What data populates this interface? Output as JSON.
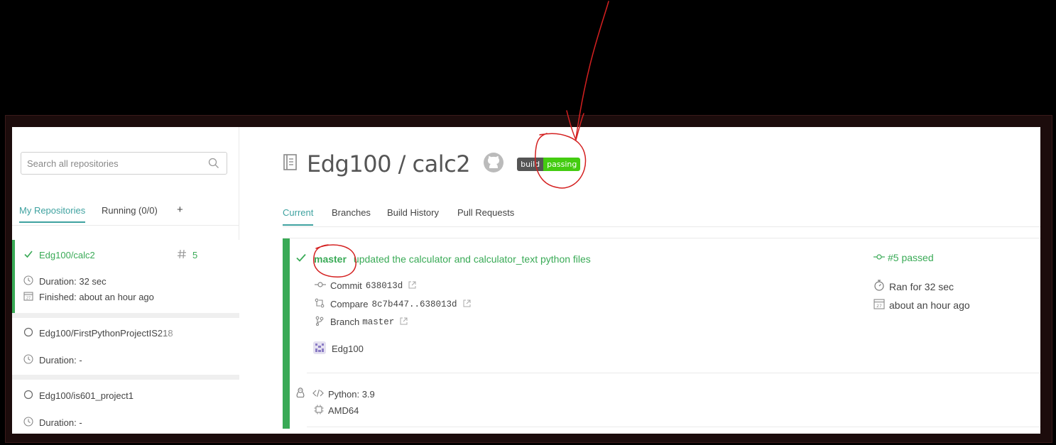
{
  "search": {
    "placeholder": "Search all repositories"
  },
  "sidebar": {
    "tabs": [
      {
        "label": "My Repositories"
      },
      {
        "label": "Running (0/0)"
      },
      {
        "label": "+"
      }
    ],
    "repos": [
      {
        "name": "Edg100/calc2",
        "build_number": "5",
        "duration": "Duration: 32 sec",
        "finished": "Finished: about an hour ago",
        "status": "passed"
      },
      {
        "name": "Edg100/FirstPythonProjectIS218",
        "duration": "Duration: -",
        "status": "none"
      },
      {
        "name": "Edg100/is601_project1",
        "duration": "Duration: -",
        "status": "none"
      }
    ]
  },
  "main": {
    "title": "Edg100 / calc2",
    "badge": {
      "left": "build",
      "right": "passing"
    },
    "tabs": [
      {
        "label": "Current"
      },
      {
        "label": "Branches"
      },
      {
        "label": "Build History"
      },
      {
        "label": "Pull Requests"
      }
    ]
  },
  "build": {
    "branch": "master",
    "message": "updated the calculator and calculator_text python files",
    "commit_label": "Commit",
    "commit_hash": "638013d",
    "compare_label": "Compare",
    "compare_range": "8c7b447..638013d",
    "branch_label": "Branch",
    "branch_name": "master",
    "author": "Edg100",
    "number_status": "#5 passed",
    "ran_for": "Ran for 32 sec",
    "finished": "about an hour ago",
    "language": "Python: 3.9",
    "arch": "AMD64"
  },
  "colors": {
    "accent": "#3fa2a0",
    "passed": "#39aa56",
    "badge_pass": "#44cc11",
    "annotation": "#d42020"
  }
}
